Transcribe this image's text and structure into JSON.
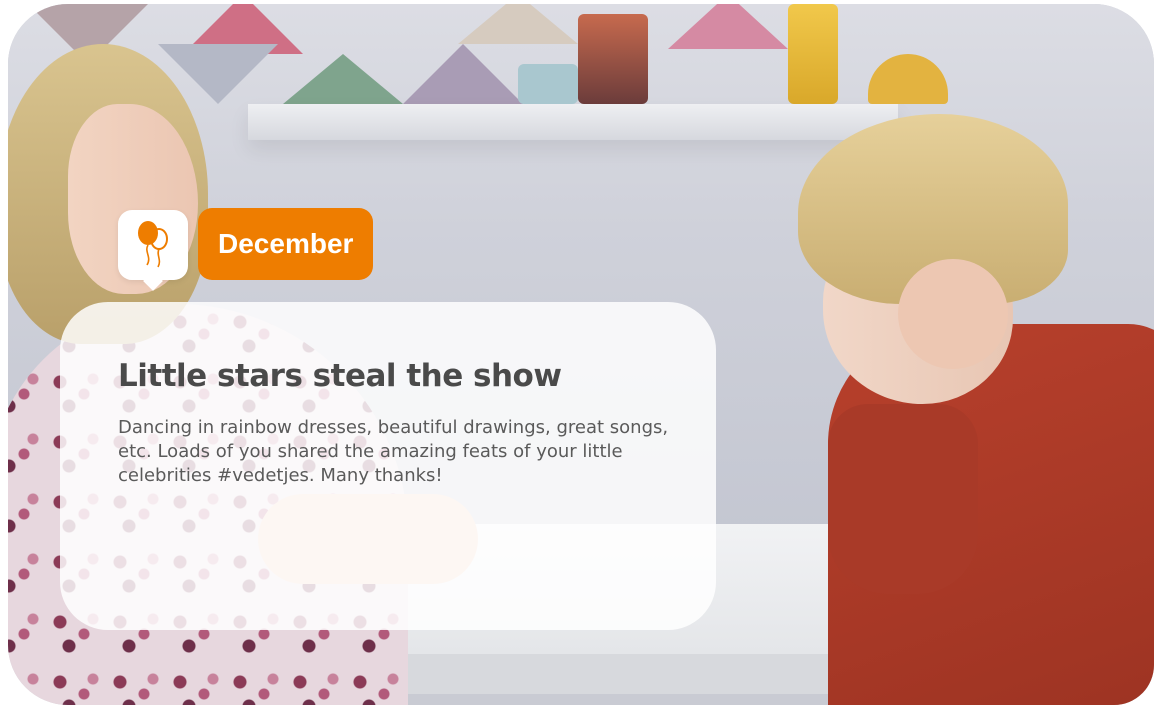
{
  "story": {
    "month": "December",
    "title": "Little stars steal the show",
    "description": "Dancing in rainbow dresses, beautiful drawings, great songs, etc. Loads of you shared the amazing feats of your little celebrities #vedetjes. Many thanks!"
  },
  "icons": {
    "badge": "balloons-icon"
  },
  "colors": {
    "accent": "#ee7d00",
    "title_text": "#4a4a4a",
    "body_text": "#5a5a5a",
    "card_background": "#ffffff"
  }
}
